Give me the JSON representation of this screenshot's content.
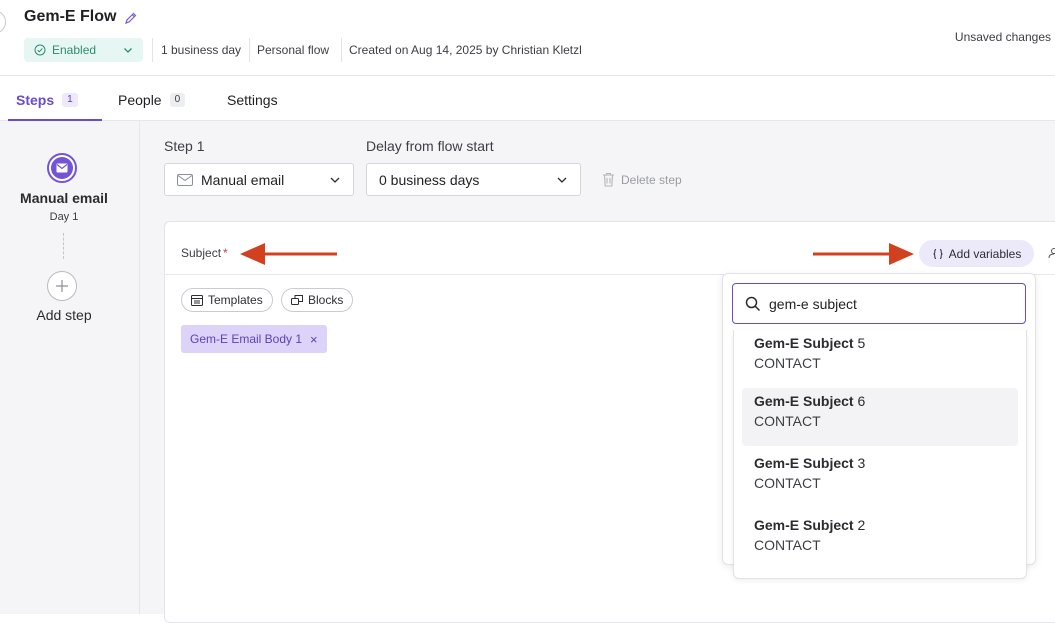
{
  "header": {
    "title": "Gem-E Flow",
    "status": "Enabled",
    "meta": [
      "1 business day",
      "Personal flow",
      "Created on Aug 14, 2025 by Christian Kletzl"
    ],
    "unsaved": "Unsaved changes"
  },
  "tabs": [
    {
      "label": "Steps",
      "count": "1"
    },
    {
      "label": "People",
      "count": "0"
    },
    {
      "label": "Settings"
    }
  ],
  "rail": {
    "step_name": "Manual email",
    "step_day": "Day 1",
    "add_step": "Add step"
  },
  "step": {
    "step_label": "Step 1",
    "step_type": "Manual email",
    "delay_label": "Delay from flow start",
    "delay_value": "0 business days",
    "delete_label": "Delete step"
  },
  "editor": {
    "subject_label": "Subject",
    "required_mark": "*",
    "add_variables": "Add variables",
    "templates": "Templates",
    "blocks": "Blocks",
    "body_chip": "Gem-E Email Body 1",
    "chip_remove": "×"
  },
  "variables_dropdown": {
    "search_value": "gem-e subject",
    "items": [
      {
        "bold": "Gem-E Subject",
        "suffix": " 5",
        "type": "CONTACT"
      },
      {
        "bold": "Gem-E Subject",
        "suffix": " 6",
        "type": "CONTACT"
      },
      {
        "bold": "Gem-E Subject",
        "suffix": " 3",
        "type": "CONTACT"
      },
      {
        "bold": "Gem-E Subject",
        "suffix": " 2",
        "type": "CONTACT"
      }
    ]
  },
  "colors": {
    "accent": "#6c4ad0",
    "enabled_bg": "#e6f6f2",
    "enabled_text": "#2f8c6f",
    "annotation_arrow": "#d1401f"
  }
}
